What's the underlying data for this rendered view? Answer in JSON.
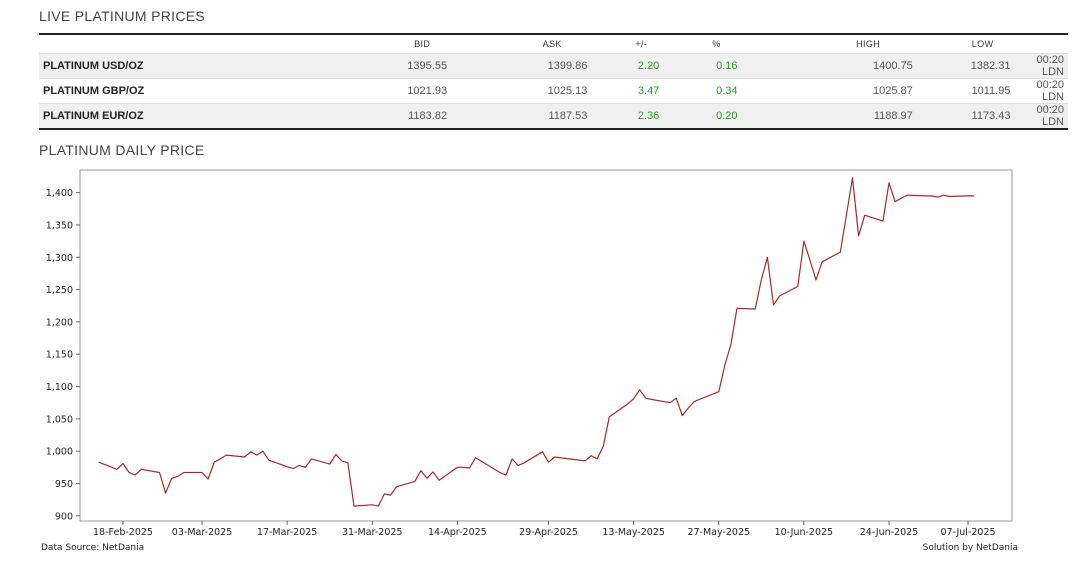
{
  "live_title": "LIVE PLATINUM PRICES",
  "chart_title": "PLATINUM DAILY PRICE",
  "table": {
    "headers": [
      "",
      "BID",
      "ASK",
      "+/-",
      "%",
      "HIGH",
      "LOW",
      ""
    ],
    "rows": [
      {
        "name": "PLATINUM USD/OZ",
        "bid": "1395.55",
        "ask": "1399.86",
        "chg": "2.20",
        "pct": "0.16",
        "high": "1400.75",
        "low": "1382.31",
        "time": "00:20 LDN"
      },
      {
        "name": "PLATINUM GBP/OZ",
        "bid": "1021.93",
        "ask": "1025.13",
        "chg": "3.47",
        "pct": "0.34",
        "high": "1025.87",
        "low": "1011.95",
        "time": "00:20 LDN"
      },
      {
        "name": "PLATINUM EUR/OZ",
        "bid": "1183.82",
        "ask": "1187.53",
        "chg": "2.36",
        "pct": "0.20",
        "high": "1188.97",
        "low": "1173.43",
        "time": "00:20 LDN"
      }
    ]
  },
  "footer": {
    "source": "Data Source: NetDania",
    "solution": "Solution by NetDania"
  },
  "colors": {
    "line": "#a52a2a",
    "positive": "#2a9a2a"
  },
  "chart_data": {
    "type": "line",
    "title": "PLATINUM DAILY PRICE",
    "xlabel": "",
    "ylabel": "",
    "ylim": [
      892,
      1435
    ],
    "grid": false,
    "yticks": [
      900,
      950,
      1000,
      1050,
      1100,
      1150,
      1200,
      1250,
      1300,
      1350,
      1400
    ],
    "ytick_labels": [
      "900",
      "950",
      "1,000",
      "1,050",
      "1,100",
      "1,150",
      "1,200",
      "1,250",
      "1,300",
      "1,350",
      "1,400"
    ],
    "xticks": [
      {
        "label": "18-Feb-2025",
        "date": "2025-02-18"
      },
      {
        "label": "03-Mar-2025",
        "date": "2025-03-03"
      },
      {
        "label": "17-Mar-2025",
        "date": "2025-03-17"
      },
      {
        "label": "31-Mar-2025",
        "date": "2025-03-31"
      },
      {
        "label": "14-Apr-2025",
        "date": "2025-04-14"
      },
      {
        "label": "29-Apr-2025",
        "date": "2025-04-29"
      },
      {
        "label": "13-May-2025",
        "date": "2025-05-13"
      },
      {
        "label": "27-May-2025",
        "date": "2025-05-27"
      },
      {
        "label": "10-Jun-2025",
        "date": "2025-06-10"
      },
      {
        "label": "24-Jun-2025",
        "date": "2025-06-24"
      },
      {
        "label": "07-Jul-2025",
        "date": "2025-07-07"
      }
    ],
    "series": [
      {
        "x": [
          "2025-02-14",
          "2025-02-17",
          "2025-02-18",
          "2025-02-19",
          "2025-02-20",
          "2025-02-21",
          "2025-02-24",
          "2025-02-25",
          "2025-02-26",
          "2025-02-27",
          "2025-02-28",
          "2025-03-03",
          "2025-03-04",
          "2025-03-05",
          "2025-03-06",
          "2025-03-07",
          "2025-03-10",
          "2025-03-11",
          "2025-03-12",
          "2025-03-13",
          "2025-03-14",
          "2025-03-17",
          "2025-03-18",
          "2025-03-19",
          "2025-03-20",
          "2025-03-21",
          "2025-03-24",
          "2025-03-25",
          "2025-03-26",
          "2025-03-27",
          "2025-03-28",
          "2025-03-31",
          "2025-04-01",
          "2025-04-02",
          "2025-04-03",
          "2025-04-04",
          "2025-04-07",
          "2025-04-08",
          "2025-04-09",
          "2025-04-10",
          "2025-04-11",
          "2025-04-14",
          "2025-04-15",
          "2025-04-16",
          "2025-04-17",
          "2025-04-21",
          "2025-04-22",
          "2025-04-23",
          "2025-04-24",
          "2025-04-25",
          "2025-04-28",
          "2025-04-29",
          "2025-04-30",
          "2025-05-05",
          "2025-05-06",
          "2025-05-07",
          "2025-05-08",
          "2025-05-09",
          "2025-05-12",
          "2025-05-13",
          "2025-05-14",
          "2025-05-15",
          "2025-05-16",
          "2025-05-19",
          "2025-05-20",
          "2025-05-21",
          "2025-05-22",
          "2025-05-23",
          "2025-05-27",
          "2025-05-28",
          "2025-05-29",
          "2025-05-30",
          "2025-06-02",
          "2025-06-03",
          "2025-06-04",
          "2025-06-05",
          "2025-06-06",
          "2025-06-09",
          "2025-06-10",
          "2025-06-11",
          "2025-06-12",
          "2025-06-13",
          "2025-06-16",
          "2025-06-17",
          "2025-06-18",
          "2025-06-19",
          "2025-06-20",
          "2025-06-23",
          "2025-06-24",
          "2025-06-25",
          "2025-06-26",
          "2025-06-27",
          "2025-06-30",
          "2025-07-01",
          "2025-07-02",
          "2025-07-03",
          "2025-07-04",
          "2025-07-07",
          "2025-07-08"
        ],
        "values": [
          983,
          972,
          981,
          967,
          963,
          972,
          967,
          935,
          958,
          961,
          967,
          967,
          957,
          983,
          988,
          994,
          991,
          999,
          994,
          1000,
          986,
          976,
          973,
          978,
          975,
          988,
          980,
          995,
          985,
          982,
          915,
          917,
          915,
          934,
          932,
          945,
          953,
          970,
          958,
          968,
          955,
          975,
          975,
          974,
          990,
          967,
          963,
          988,
          978,
          982,
          999,
          983,
          991,
          985,
          993,
          988,
          1008,
          1053,
          1073,
          1081,
          1095,
          1082,
          1080,
          1075,
          1082,
          1055,
          1067,
          1077,
          1092,
          1133,
          1165,
          1221,
          1220,
          1265,
          1300,
          1226,
          1240,
          1255,
          1325,
          1296,
          1265,
          1293,
          1308,
          1365,
          1423,
          1333,
          1365,
          1356,
          1415,
          1386,
          1391,
          1396,
          1395,
          1395,
          1393,
          1396,
          1394,
          1395,
          1395
        ],
        "note_x_are_dates": true
      }
    ]
  }
}
